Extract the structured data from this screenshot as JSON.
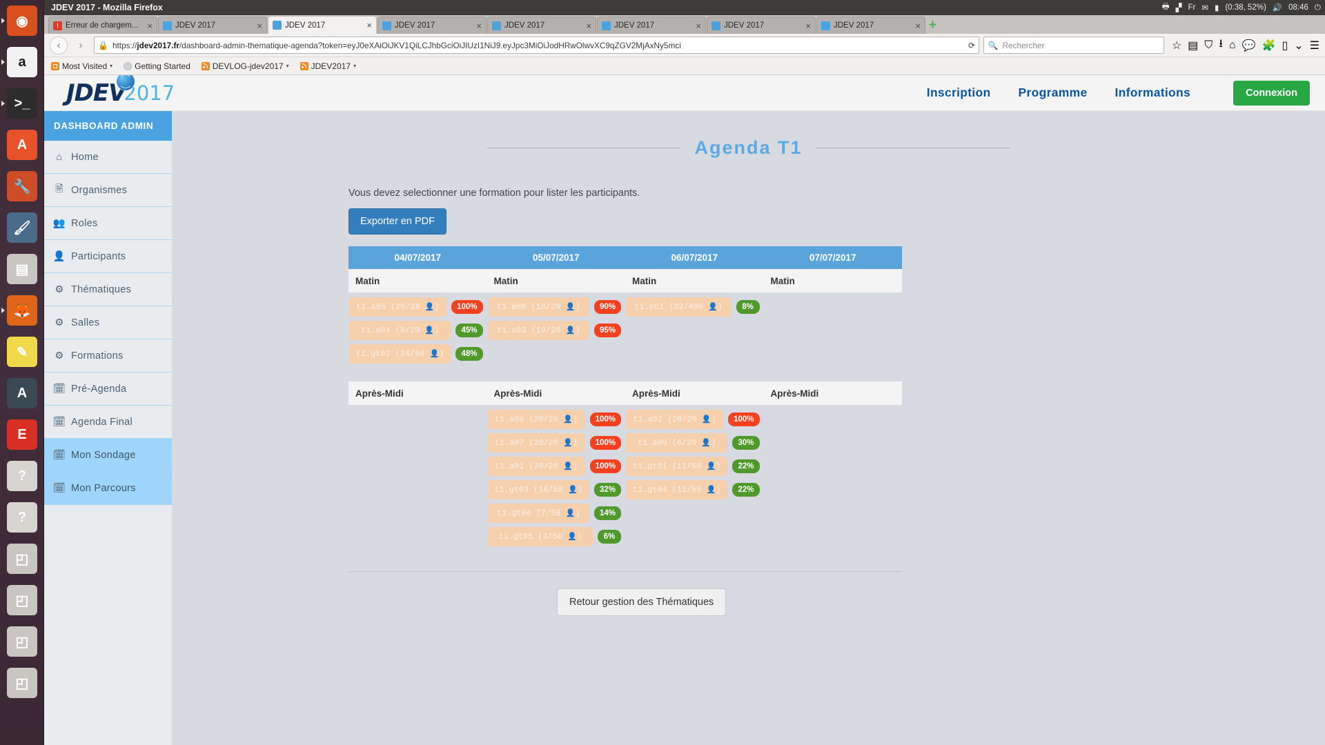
{
  "window": {
    "title": "JDEV 2017 - Mozilla Firefox",
    "clock": "08:46",
    "battery": "(0:38, 52%)",
    "keyboard": "Fr"
  },
  "tabs": [
    {
      "label": "Erreur de chargem...",
      "favicon": "error-icon",
      "active": false
    },
    {
      "label": "JDEV 2017",
      "favicon": "page-icon",
      "active": false
    },
    {
      "label": "JDEV 2017",
      "favicon": "page-icon",
      "active": true
    },
    {
      "label": "JDEV 2017",
      "favicon": "page-icon",
      "active": false
    },
    {
      "label": "JDEV 2017",
      "favicon": "page-icon",
      "active": false
    },
    {
      "label": "JDEV 2017",
      "favicon": "page-icon",
      "active": false
    },
    {
      "label": "JDEV 2017",
      "favicon": "page-icon",
      "active": false
    },
    {
      "label": "JDEV 2017",
      "favicon": "page-icon",
      "active": false
    }
  ],
  "newtab_label": "+",
  "urlbar": {
    "scheme": "https://",
    "host": "jdev2017.fr",
    "path": "/dashboard-admin-thematique-agenda?token=eyJ0eXAiOiJKV1QiLCJhbGciOiJIUzI1NiJ9.eyJpc3MiOiJodHRwOlwvXC9qZGV2MjAxNy5mci"
  },
  "search": {
    "placeholder": "Rechercher"
  },
  "bookmarks": [
    {
      "label": "Most Visited",
      "icon": "most-visited-icon",
      "caret": true
    },
    {
      "label": "Getting Started",
      "icon": "globe-icon",
      "caret": false
    },
    {
      "label": "DEVLOG-jdev2017",
      "icon": "rss-icon",
      "caret": true
    },
    {
      "label": "JDEV2017",
      "icon": "rss-icon",
      "caret": true
    }
  ],
  "site": {
    "logo_main": "JDEV",
    "logo_year": "2017",
    "nav": [
      {
        "label": "Inscription"
      },
      {
        "label": "Programme"
      },
      {
        "label": "Informations"
      }
    ],
    "login_label": "Connexion",
    "login_color": "#28a745"
  },
  "sidebar": {
    "title": "DASHBOARD ADMIN",
    "items": [
      {
        "label": "Home",
        "icon": "home-icon",
        "active": false
      },
      {
        "label": "Organismes",
        "icon": "document-icon",
        "active": false
      },
      {
        "label": "Roles",
        "icon": "users-icon",
        "active": false
      },
      {
        "label": "Participants",
        "icon": "user-icon",
        "active": false
      },
      {
        "label": "Thématiques",
        "icon": "gears-icon",
        "active": false
      },
      {
        "label": "Salles",
        "icon": "gears-icon",
        "active": false
      },
      {
        "label": "Formations",
        "icon": "gears-icon",
        "active": false
      },
      {
        "label": "Pré-Agenda",
        "icon": "calendar-icon",
        "active": false
      },
      {
        "label": "Agenda Final",
        "icon": "calendar-grid-icon",
        "active": false
      },
      {
        "label": "Mon Sondage",
        "icon": "calendar-icon",
        "active": true
      },
      {
        "label": "Mon Parcours",
        "icon": "calendar-grid-icon",
        "active": true
      }
    ]
  },
  "main": {
    "page_title": "Agenda T1",
    "notice": "Vous devez selectionner une formation pour lister les participants.",
    "export_label": "Exporter en PDF",
    "back_label": "Retour gestion des Thématiques",
    "columns": [
      "04/07/2017",
      "05/07/2017",
      "06/07/2017",
      "07/07/2017"
    ],
    "slot_morning": "Matin",
    "slot_afternoon": "Après-Midi",
    "morning": [
      [
        {
          "code": "t1.a05",
          "count": "(20/20",
          "pct": "100%",
          "color": "red"
        },
        {
          "code": "t1.a04",
          "count": "(9/20",
          "pct": "45%",
          "color": "green"
        },
        {
          "code": "t1.gt02",
          "count": "(24/50",
          "pct": "48%",
          "color": "green"
        }
      ],
      [
        {
          "code": "t1.a08",
          "count": "(18/20",
          "pct": "90%",
          "color": "red"
        },
        {
          "code": "t1.a03",
          "count": "(19/20",
          "pct": "95%",
          "color": "red"
        }
      ],
      [
        {
          "code": "t1.p01",
          "count": "(32/400",
          "pct": "8%",
          "color": "green"
        }
      ],
      []
    ],
    "afternoon": [
      [],
      [
        {
          "code": "t1.a06",
          "count": "(20/20",
          "pct": "100%",
          "color": "red"
        },
        {
          "code": "t1.a07",
          "count": "(20/20",
          "pct": "100%",
          "color": "red"
        },
        {
          "code": "t1.a01",
          "count": "(20/20",
          "pct": "100%",
          "color": "red"
        },
        {
          "code": "t1.gt03",
          "count": "(16/50",
          "pct": "32%",
          "color": "green"
        },
        {
          "code": "t1.gt06",
          "count": "(7/50",
          "pct": "14%",
          "color": "green"
        },
        {
          "code": "t1.gt05",
          "count": "(3/50",
          "pct": "6%",
          "color": "green"
        }
      ],
      [
        {
          "code": "t1.a02",
          "count": "(20/20",
          "pct": "100%",
          "color": "red"
        },
        {
          "code": "t1.a09",
          "count": "(6/20",
          "pct": "30%",
          "color": "green"
        },
        {
          "code": "t1.gt01",
          "count": "(11/50",
          "pct": "22%",
          "color": "green"
        },
        {
          "code": "t1.gt04",
          "count": "(11/50",
          "pct": "22%",
          "color": "green"
        }
      ],
      []
    ]
  },
  "launcher": [
    {
      "name": "ubuntu-dash",
      "glyph": "◉",
      "bg": "#d94f1e"
    },
    {
      "name": "amazon",
      "glyph": "a",
      "bg": "#f2f2f2",
      "fg": "#1b1b1b"
    },
    {
      "name": "terminal",
      "glyph": "&gt;_",
      "bg": "#2c2c2c"
    },
    {
      "name": "software-center",
      "glyph": "A",
      "bg": "#e8522a"
    },
    {
      "name": "system-settings",
      "glyph": "🔧",
      "bg": "#cf4c28"
    },
    {
      "name": "gimp",
      "glyph": "🖌",
      "bg": "#4a6b8a"
    },
    {
      "name": "files",
      "glyph": "▤",
      "bg": "#c9c5c1"
    },
    {
      "name": "firefox",
      "glyph": "🦊",
      "bg": "#e2661a"
    },
    {
      "name": "text-editor",
      "glyph": "✎",
      "bg": "#f0d94a"
    },
    {
      "name": "android-studio",
      "glyph": "A",
      "bg": "#3b4a52"
    },
    {
      "name": "evernote",
      "glyph": "E",
      "bg": "#d93025"
    },
    {
      "name": "help",
      "glyph": "?",
      "bg": "#d7d3cf"
    },
    {
      "name": "help2",
      "glyph": "?",
      "bg": "#d7d3cf"
    },
    {
      "name": "disk1",
      "glyph": "◰",
      "bg": "#c9c5c1"
    },
    {
      "name": "disk2",
      "glyph": "◰",
      "bg": "#c9c5c1"
    },
    {
      "name": "disk3",
      "glyph": "◰",
      "bg": "#c9c5c1"
    },
    {
      "name": "disk4",
      "glyph": "◰",
      "bg": "#c9c5c1"
    }
  ]
}
